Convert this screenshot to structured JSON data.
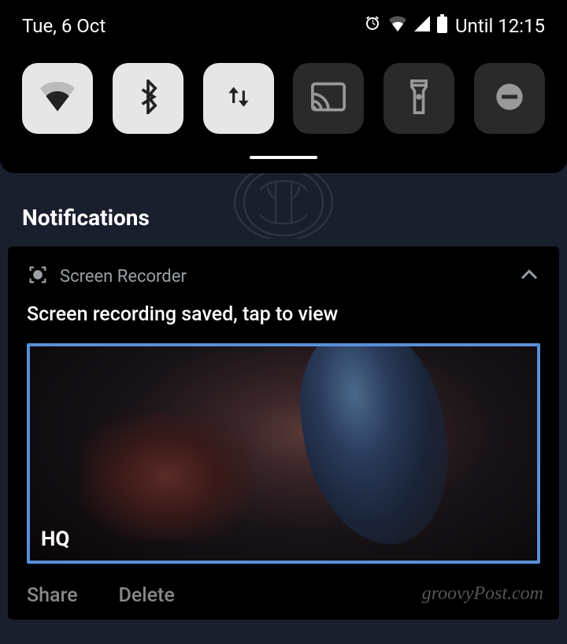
{
  "status": {
    "date": "Tue, 6 Oct",
    "until_label": "Until 12:15"
  },
  "qs": {
    "tiles": [
      {
        "name": "wifi",
        "active": true
      },
      {
        "name": "bluetooth",
        "active": true
      },
      {
        "name": "mobile-data",
        "active": true
      },
      {
        "name": "cast",
        "active": false
      },
      {
        "name": "flashlight",
        "active": false
      },
      {
        "name": "dnd",
        "active": false
      }
    ]
  },
  "notifications_header": "Notifications",
  "notification": {
    "app_name": "Screen Recorder",
    "title": "Screen recording saved, tap to view",
    "badge": "HQ",
    "actions": {
      "share": "Share",
      "delete": "Delete"
    }
  },
  "watermark": "groovyPost.com"
}
